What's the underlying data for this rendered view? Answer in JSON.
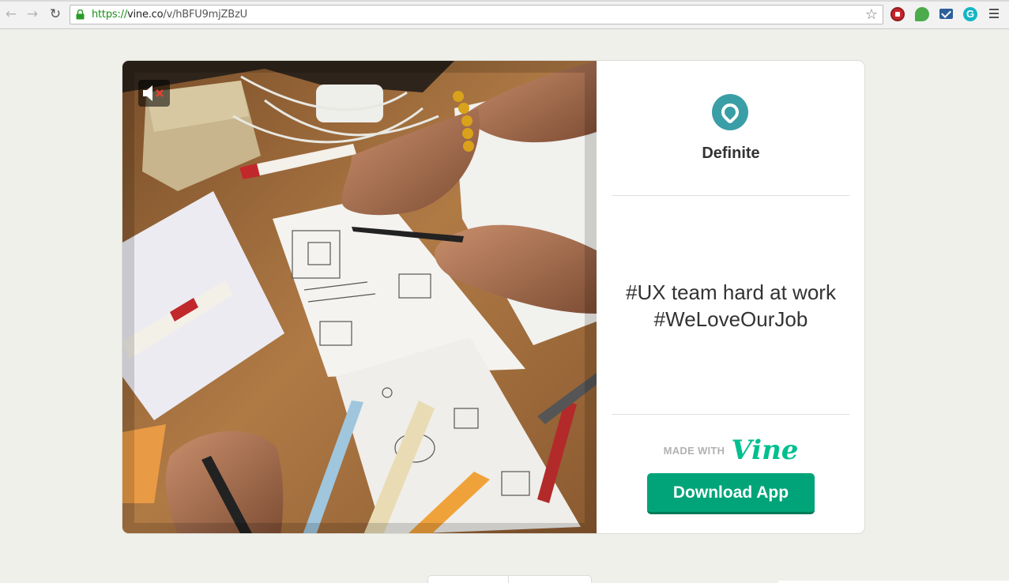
{
  "browser": {
    "url_scheme": "https://",
    "url_host": "vine.co",
    "url_path": "/v/hBFU9mjZBzU",
    "back_icon": "←",
    "forward_icon": "→",
    "reload_icon": "↻",
    "star_icon": "☆",
    "grammarly_label": "G"
  },
  "post": {
    "author": "Definite",
    "caption_line1": "#UX team hard at work",
    "caption_line2": "#WeLoveOurJob",
    "made_with": "MADE WITH",
    "brand": "Vine",
    "download_label": "Download App"
  },
  "colors": {
    "brand_green": "#00bf8f",
    "button_green": "#00a478",
    "avatar_teal": "#3a9ea6"
  }
}
